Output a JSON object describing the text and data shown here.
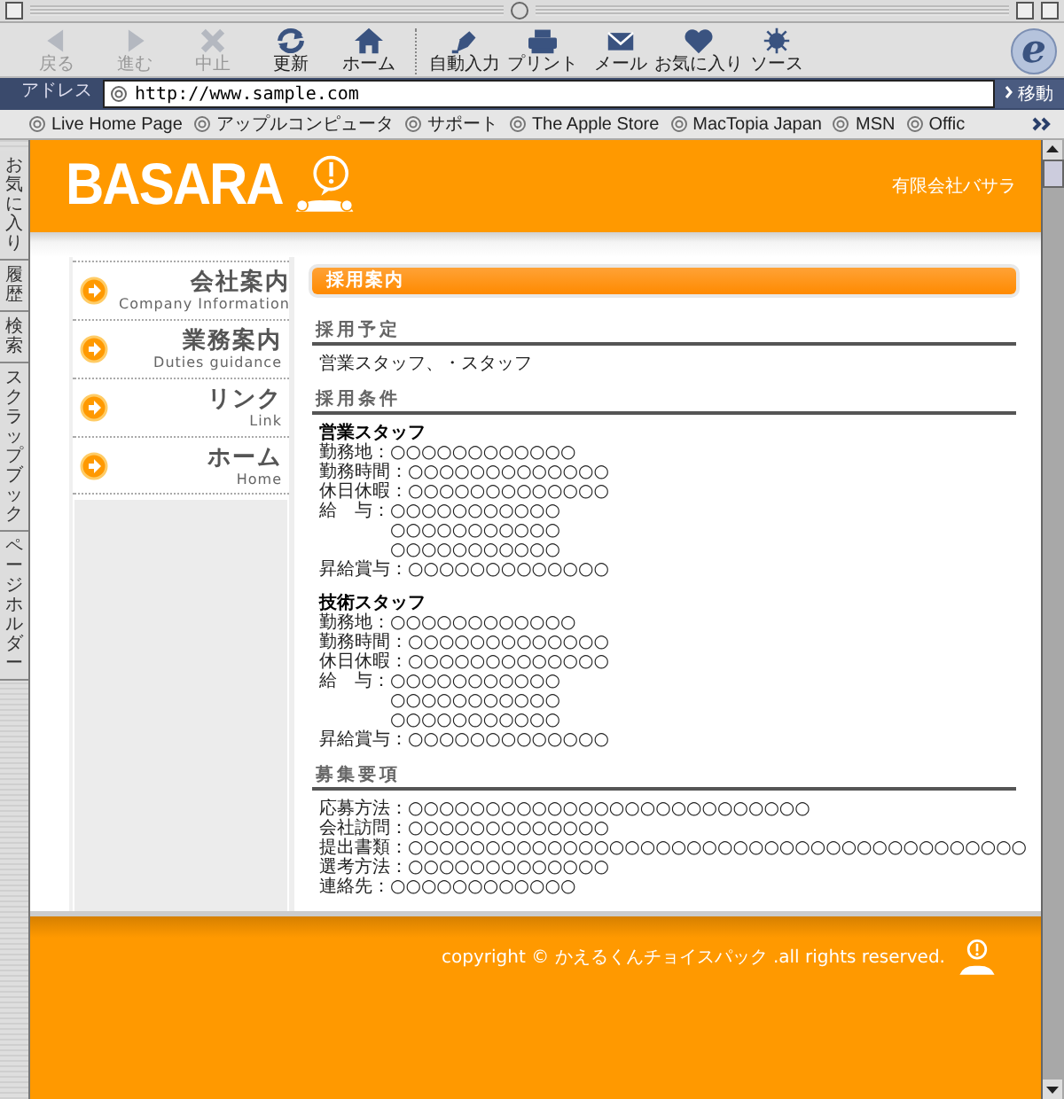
{
  "browser": {
    "toolbar": [
      {
        "label": "戻る",
        "disabled": true
      },
      {
        "label": "進む",
        "disabled": true
      },
      {
        "label": "中止",
        "disabled": true
      },
      {
        "label": "更新",
        "disabled": false
      },
      {
        "label": "ホーム",
        "disabled": false
      },
      {
        "label": "自動入力",
        "disabled": false
      },
      {
        "label": "プリント",
        "disabled": false
      },
      {
        "label": "メール",
        "disabled": false
      },
      {
        "label": "お気に入り",
        "disabled": false
      },
      {
        "label": "ソース",
        "disabled": false
      }
    ],
    "logo_letter": "e",
    "address": {
      "label": "アドレス",
      "value": "http://www.sample.com",
      "go": "移動"
    },
    "favorites": [
      "Live Home Page",
      "アップルコンピュータ",
      "サポート",
      "The Apple Store",
      "MacTopia Japan",
      "MSN",
      "Offic"
    ],
    "side_tabs": [
      "お気に入り",
      "履歴",
      "検索",
      "スクラップブック",
      "ページホルダー"
    ]
  },
  "page": {
    "logo": "BASARA",
    "company": "有限会社バサラ",
    "nav": [
      {
        "title": "会社案内",
        "subtitle": "Company Information"
      },
      {
        "title": "業務案内",
        "subtitle": "Duties guidance"
      },
      {
        "title": "リンク",
        "subtitle": "Link"
      },
      {
        "title": "ホーム",
        "subtitle": "Home"
      }
    ],
    "section_title": "採用案内",
    "sections": [
      {
        "heading": "採用予定",
        "groups": [
          {
            "lines": [
              {
                "values": [
                  "営業スタッフ、・スタッフ"
                ]
              }
            ]
          }
        ]
      },
      {
        "heading": "採用条件",
        "groups": [
          {
            "title": "営業スタッフ",
            "lines": [
              {
                "label": "勤務地：",
                "values": [
                  "○○○○○○○○○○○○"
                ]
              },
              {
                "label": "勤務時間：",
                "values": [
                  "○○○○○○○○○○○○○"
                ]
              },
              {
                "label": "休日休暇：",
                "values": [
                  "○○○○○○○○○○○○○"
                ]
              },
              {
                "label": "給　与：",
                "values": [
                  "○○○○○○○○○○○",
                  "○○○○○○○○○○○",
                  "○○○○○○○○○○○"
                ]
              },
              {
                "label": "昇給賞与：",
                "values": [
                  "○○○○○○○○○○○○○"
                ]
              }
            ]
          },
          {
            "title": "技術スタッフ",
            "lines": [
              {
                "label": "勤務地：",
                "values": [
                  "○○○○○○○○○○○○"
                ]
              },
              {
                "label": "勤務時間：",
                "values": [
                  "○○○○○○○○○○○○○"
                ]
              },
              {
                "label": "休日休暇：",
                "values": [
                  "○○○○○○○○○○○○○"
                ]
              },
              {
                "label": "給　与：",
                "values": [
                  "○○○○○○○○○○○",
                  "○○○○○○○○○○○",
                  "○○○○○○○○○○○"
                ]
              },
              {
                "label": "昇給賞与：",
                "values": [
                  "○○○○○○○○○○○○○"
                ]
              }
            ]
          }
        ]
      },
      {
        "heading": "募集要項",
        "groups": [
          {
            "lines": [
              {
                "label": "応募方法：",
                "values": [
                  "○○○○○○○○○○○○○○○○○○○○○○○○○○"
                ]
              },
              {
                "label": "会社訪問：",
                "values": [
                  "○○○○○○○○○○○○○"
                ]
              },
              {
                "label": "提出書類：",
                "values": [
                  "○○○○○○○○○○○○○○○○○○○○○○○○○○○○○○○○○○○○○○○○"
                ]
              },
              {
                "label": "選考方法：",
                "values": [
                  "○○○○○○○○○○○○○"
                ]
              },
              {
                "label": "連絡先：",
                "values": [
                  "○○○○○○○○○○○○"
                ]
              }
            ]
          }
        ]
      }
    ],
    "copyright": "copyright © かえるくんチョイスパック .all rights reserved."
  }
}
